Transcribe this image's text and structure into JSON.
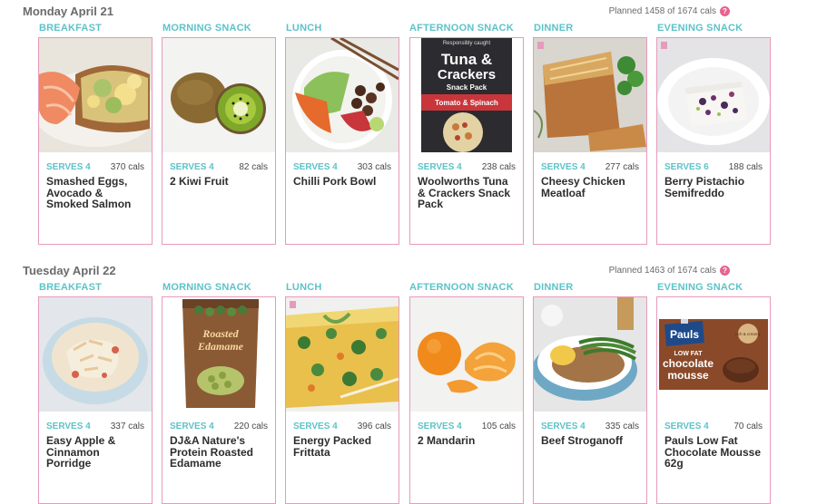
{
  "days": [
    {
      "title": "Monday April 21",
      "planned": "Planned 1458 of 1674 cals",
      "meals": [
        {
          "slot": "BREAKFAST",
          "serves": "SERVES 4",
          "cals": "370 cals",
          "title": "Smashed Eggs, Avocado & Smoked Salmon",
          "image": "smashed-eggs-salmon"
        },
        {
          "slot": "MORNING SNACK",
          "serves": "SERVES 4",
          "cals": "82 cals",
          "title": "2 Kiwi Fruit",
          "image": "kiwi-fruit"
        },
        {
          "slot": "LUNCH",
          "serves": "SERVES 4",
          "cals": "303 cals",
          "title": "Chilli Pork Bowl",
          "image": "chilli-pork-bowl"
        },
        {
          "slot": "AFTERNOON SNACK",
          "serves": "SERVES 4",
          "cals": "238 cals",
          "title": "Woolworths Tuna & Crackers Snack Pack",
          "image": "tuna-crackers-pack",
          "pack": {
            "top": "Responsibly caught",
            "line1": "Tuna &",
            "line2": "Crackers",
            "line3": "Snack Pack",
            "flavour": "Tomato & Spinach"
          }
        },
        {
          "slot": "DINNER",
          "serves": "SERVES 4",
          "cals": "277 cals",
          "title": "Cheesy Chicken Meatloaf",
          "image": "chicken-meatloaf"
        },
        {
          "slot": "EVENING SNACK",
          "serves": "SERVES 6",
          "cals": "188 cals",
          "title": "Berry Pistachio Semifreddo",
          "image": "berry-semifreddo"
        }
      ]
    },
    {
      "title": "Tuesday April 22",
      "planned": "Planned 1463 of 1674 cals",
      "meals": [
        {
          "slot": "BREAKFAST",
          "serves": "SERVES 4",
          "cals": "337 cals",
          "title": "Easy Apple & Cinnamon Porridge",
          "image": "apple-porridge"
        },
        {
          "slot": "MORNING SNACK",
          "serves": "SERVES 4",
          "cals": "220 cals",
          "title": "DJ&A Nature's Protein Roasted Edamame",
          "image": "roasted-edamame",
          "pack": {
            "line1": "Roasted",
            "line2": "Edamame"
          }
        },
        {
          "slot": "LUNCH",
          "serves": "SERVES 4",
          "cals": "396 cals",
          "title": "Energy Packed Frittata",
          "image": "frittata"
        },
        {
          "slot": "AFTERNOON SNACK",
          "serves": "SERVES 4",
          "cals": "105 cals",
          "title": "2 Mandarin",
          "image": "mandarins"
        },
        {
          "slot": "DINNER",
          "serves": "SERVES 4",
          "cals": "335 cals",
          "title": "Beef Stroganoff",
          "image": "beef-stroganoff"
        },
        {
          "slot": "EVENING SNACK",
          "serves": "SERVES 4",
          "cals": "70 cals",
          "title": "Pauls Low Fat Chocolate Mousse 62g",
          "image": "chocolate-mousse",
          "pack": {
            "brand": "Pauls",
            "line1": "LOW FAT",
            "line2": "chocolate",
            "line3": "mousse",
            "tag": "rich & creamy"
          }
        }
      ]
    }
  ],
  "colors": {
    "accent": "#5cc3c8",
    "border": "#e79abc",
    "help": "#e8618f"
  }
}
